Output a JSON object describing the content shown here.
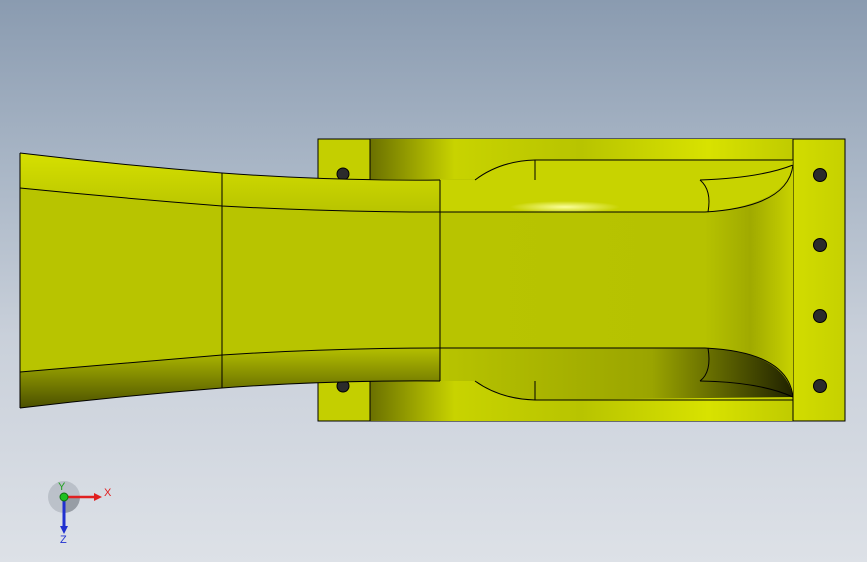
{
  "viewport": {
    "background_top": "#8a9bb0",
    "background_bottom": "#dde1e7"
  },
  "model": {
    "part_color": "#b8c400",
    "part_highlight": "#e6f060",
    "part_shadow": "#3a3d00",
    "edge_color": "#000000",
    "hole_color": "#2a2a2a"
  },
  "triad": {
    "x_label": "X",
    "y_label": "Y",
    "z_label": "Z",
    "x_color": "#e02020",
    "y_color": "#20c020",
    "z_color": "#2030d0"
  }
}
